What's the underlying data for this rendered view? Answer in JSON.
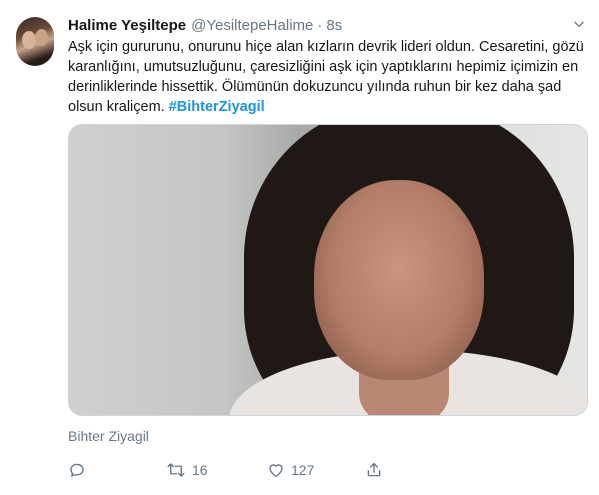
{
  "user": {
    "display_name": "Halime Yeşiltepe",
    "handle": "@YesiltepeHalime",
    "separator": "·",
    "time": "8s",
    "avatar_icon": "avatar-photo"
  },
  "tweet": {
    "text": "Aşk için gururunu, onurunu hiçe alan kızların devrik lideri oldun. Cesaretini, gözü karanlığını, umutsuzluğunu, çaresizliğini aşk için yaptıklarını hepimiz içimizin en derinliklerinde hissettik. Ölümünün dokuzuncu yılında ruhun bir kez daha şad olsun kraliçem.",
    "hashtag": "#BihterZiyagil",
    "hashtag_color": "#1b95e0",
    "media_caption": "Bihter Ziyagil"
  },
  "actions": {
    "reply_icon": "reply-icon",
    "retweet_icon": "retweet-icon",
    "retweet_count": "16",
    "like_icon": "heart-icon",
    "like_count": "127",
    "share_icon": "share-icon"
  },
  "colors": {
    "text": "#14171a",
    "secondary": "#657786"
  }
}
